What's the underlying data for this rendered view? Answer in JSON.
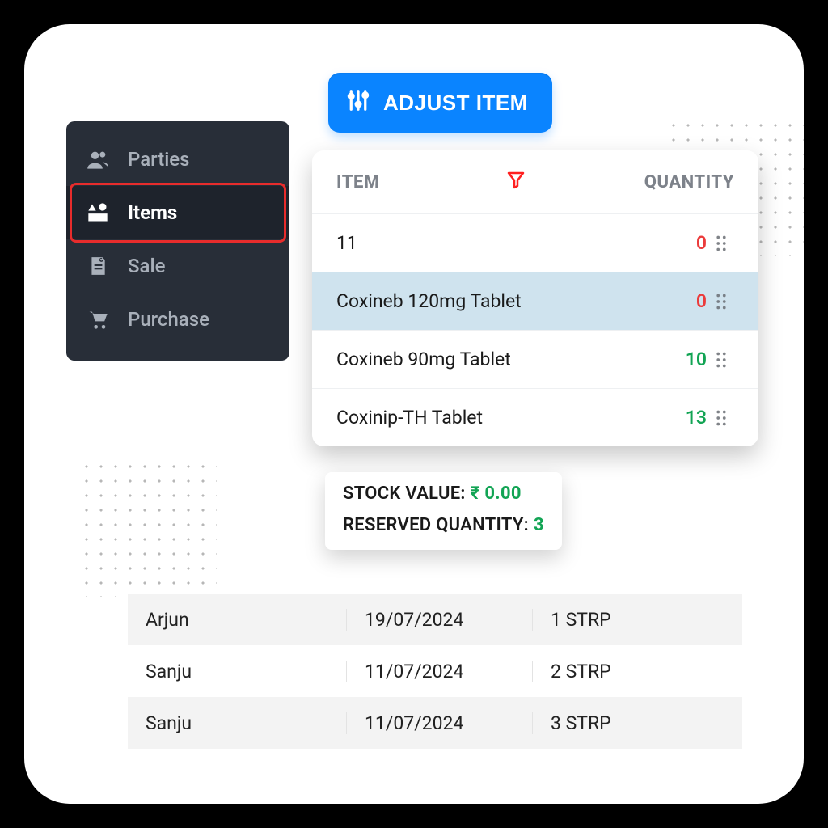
{
  "sidebar": {
    "items": [
      {
        "label": "Parties",
        "icon": "users"
      },
      {
        "label": "Items",
        "icon": "shapes",
        "active": true
      },
      {
        "label": "Sale",
        "icon": "invoice"
      },
      {
        "label": "Purchase",
        "icon": "cart"
      }
    ]
  },
  "toolbar": {
    "adjust_label": "ADJUST ITEM"
  },
  "item_table": {
    "header_item": "ITEM",
    "header_quantity": "QUANTITY",
    "rows": [
      {
        "name": "11",
        "qty": "0",
        "qty_color": "zero"
      },
      {
        "name": "Coxineb 120mg Tablet",
        "qty": "0",
        "qty_color": "zero",
        "selected": true
      },
      {
        "name": "Coxineb 90mg Tablet",
        "qty": "10",
        "qty_color": "pos"
      },
      {
        "name": "Coxinip-TH Tablet",
        "qty": "13",
        "qty_color": "pos"
      }
    ]
  },
  "stock": {
    "stock_value_label": "STOCK VALUE: ",
    "stock_value": "₹ 0.00",
    "reserved_label": "RESERVED QUANTITY: ",
    "reserved_value": "3"
  },
  "transactions": [
    {
      "name": "Arjun",
      "date": "19/07/2024",
      "qty": "1 STRP"
    },
    {
      "name": "Sanju",
      "date": "11/07/2024",
      "qty": "2 STRP"
    },
    {
      "name": "Sanju",
      "date": "11/07/2024",
      "qty": "3 STRP"
    }
  ],
  "colors": {
    "primary": "#0a84ff",
    "danger": "#eb3b3b",
    "success": "#12a454",
    "sidebar_bg": "#282e38"
  }
}
